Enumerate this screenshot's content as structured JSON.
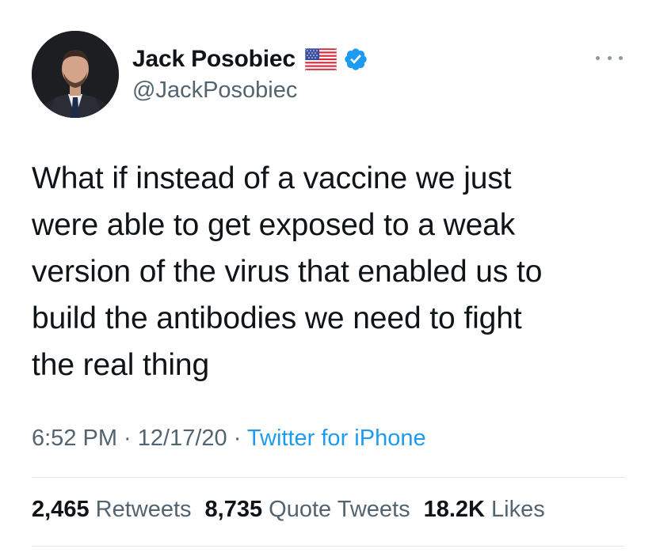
{
  "author": {
    "display_name": "Jack Posobiec",
    "handle": "@JackPosobiec",
    "flag_icon": "us-flag-icon",
    "verified_icon": "verified-badge-icon",
    "verified_color": "#1d9bf0"
  },
  "more_icon": "more-horizontal-icon",
  "tweet": {
    "text": "What if instead of a vaccine we just\nwere able to get exposed to a weak\nversion of the virus that enabled us to\nbuild the antibodies we need to fight\nthe real thing"
  },
  "meta": {
    "time": "6:52 PM",
    "separator": " · ",
    "date": "12/17/20",
    "source": "Twitter for iPhone"
  },
  "stats": {
    "retweets_count": "2,465",
    "retweets_label": "Retweets",
    "quotes_count": "8,735",
    "quotes_label": "Quote Tweets",
    "likes_count": "18.2K",
    "likes_label": "Likes"
  },
  "colors": {
    "text": "#0f1419",
    "secondary": "#536471",
    "link": "#1d9bf0",
    "divider": "#e1e8ed"
  }
}
